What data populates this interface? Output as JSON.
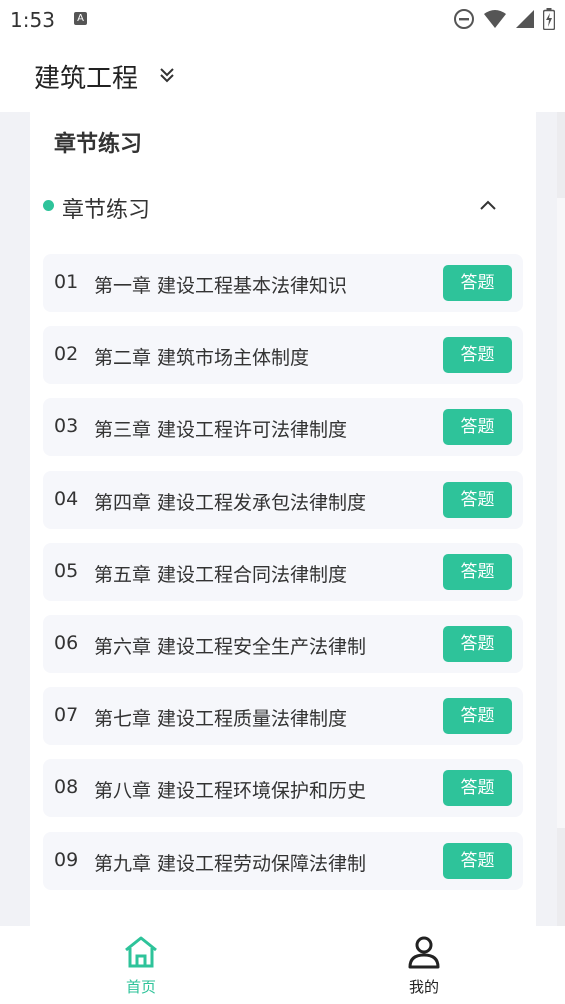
{
  "status_bar": {
    "time": "1:53",
    "notification_icon": "a-icon",
    "right_icons": [
      "do-not-disturb-icon",
      "wifi-icon",
      "signal-icon",
      "battery-icon"
    ]
  },
  "header": {
    "title": "建筑工程",
    "chevron_icon": "double-chevron-down-icon"
  },
  "card": {
    "title": "章节练习",
    "section": {
      "label": "章节练习",
      "toggle_icon": "chevron-up-icon",
      "accent_color": "#2ec39a"
    },
    "button_label": "答题",
    "chapters": [
      {
        "num": "01",
        "title": "第一章 建设工程基本法律知识"
      },
      {
        "num": "02",
        "title": "第二章 建筑市场主体制度"
      },
      {
        "num": "03",
        "title": "第三章 建设工程许可法律制度"
      },
      {
        "num": "04",
        "title": "第四章 建设工程发承包法律制度"
      },
      {
        "num": "05",
        "title": "第五章 建设工程合同法律制度"
      },
      {
        "num": "06",
        "title": "第六章 建设工程安全生产法律制"
      },
      {
        "num": "07",
        "title": "第七章 建设工程质量法律制度"
      },
      {
        "num": "08",
        "title": "第八章 建设工程环境保护和历史"
      },
      {
        "num": "09",
        "title": "第九章 建设工程劳动保障法律制"
      }
    ]
  },
  "tabs": [
    {
      "label": "首页",
      "icon": "home-icon",
      "active": true,
      "color": "#2ec39a"
    },
    {
      "label": "我的",
      "icon": "user-icon",
      "active": false,
      "color": "#222222"
    }
  ]
}
